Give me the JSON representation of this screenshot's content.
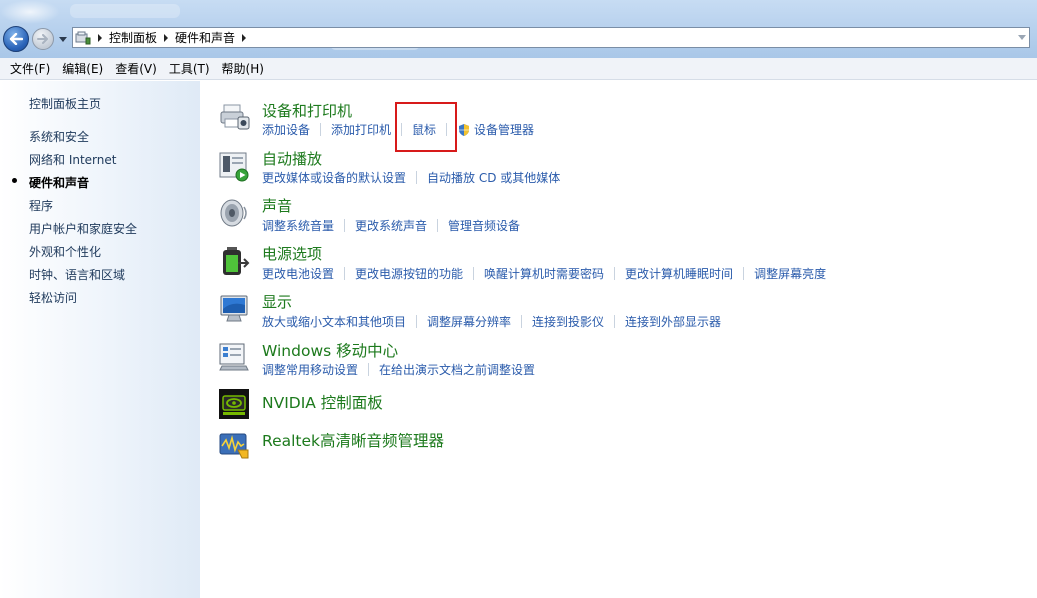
{
  "address": {
    "crumbs": [
      "控制面板",
      "硬件和声音"
    ]
  },
  "menu": [
    "文件(F)",
    "编辑(E)",
    "查看(V)",
    "工具(T)",
    "帮助(H)"
  ],
  "sidebar": {
    "items": [
      {
        "label": "控制面板主页"
      },
      {
        "label": "系统和安全"
      },
      {
        "label": "网络和 Internet"
      },
      {
        "label": "硬件和声音",
        "active": true
      },
      {
        "label": "程序"
      },
      {
        "label": "用户帐户和家庭安全"
      },
      {
        "label": "外观和个性化"
      },
      {
        "label": "时钟、语言和区域"
      },
      {
        "label": "轻松访问"
      }
    ]
  },
  "categories": [
    {
      "title": "设备和打印机",
      "icon": "printer-icon",
      "links": [
        "添加设备",
        "添加打印机",
        "鼠标",
        "设备管理器"
      ]
    },
    {
      "title": "自动播放",
      "icon": "autoplay-icon",
      "links": [
        "更改媒体或设备的默认设置",
        "自动播放 CD 或其他媒体"
      ]
    },
    {
      "title": "声音",
      "icon": "speaker-icon",
      "links": [
        "调整系统音量",
        "更改系统声音",
        "管理音频设备"
      ]
    },
    {
      "title": "电源选项",
      "icon": "battery-icon",
      "links": [
        "更改电池设置",
        "更改电源按钮的功能",
        "唤醒计算机时需要密码",
        "更改计算机睡眠时间",
        "调整屏幕亮度"
      ]
    },
    {
      "title": "显示",
      "icon": "monitor-icon",
      "links": [
        "放大或缩小文本和其他项目",
        "调整屏幕分辨率",
        "连接到投影仪",
        "连接到外部显示器"
      ]
    },
    {
      "title": "Windows 移动中心",
      "icon": "mobility-center-icon",
      "links": [
        "调整常用移动设置",
        "在给出演示文档之前调整设置"
      ]
    },
    {
      "title": "NVIDIA 控制面板",
      "icon": "nvidia-icon",
      "links": []
    },
    {
      "title": "Realtek高清晰音频管理器",
      "icon": "realtek-audio-icon",
      "links": []
    }
  ],
  "colors": {
    "link": "#2a5bab",
    "category_title": "#1d7a1d",
    "highlight": "#d71a1a"
  }
}
